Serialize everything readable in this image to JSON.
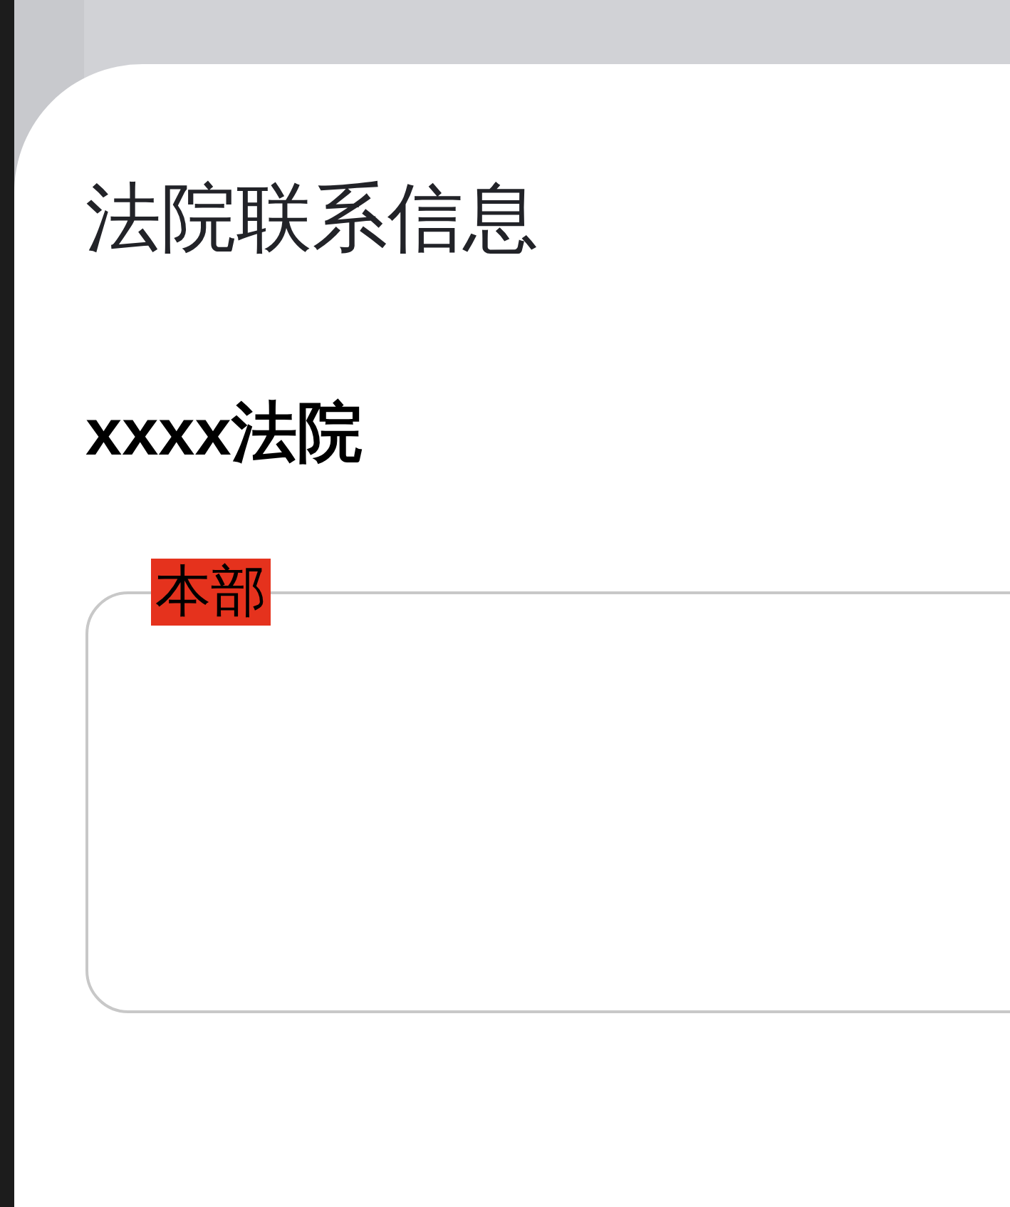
{
  "page": {
    "title": "法院联系信息"
  },
  "court": {
    "name": "xxxx法院",
    "sections": [
      {
        "label": "本部"
      }
    ]
  }
}
